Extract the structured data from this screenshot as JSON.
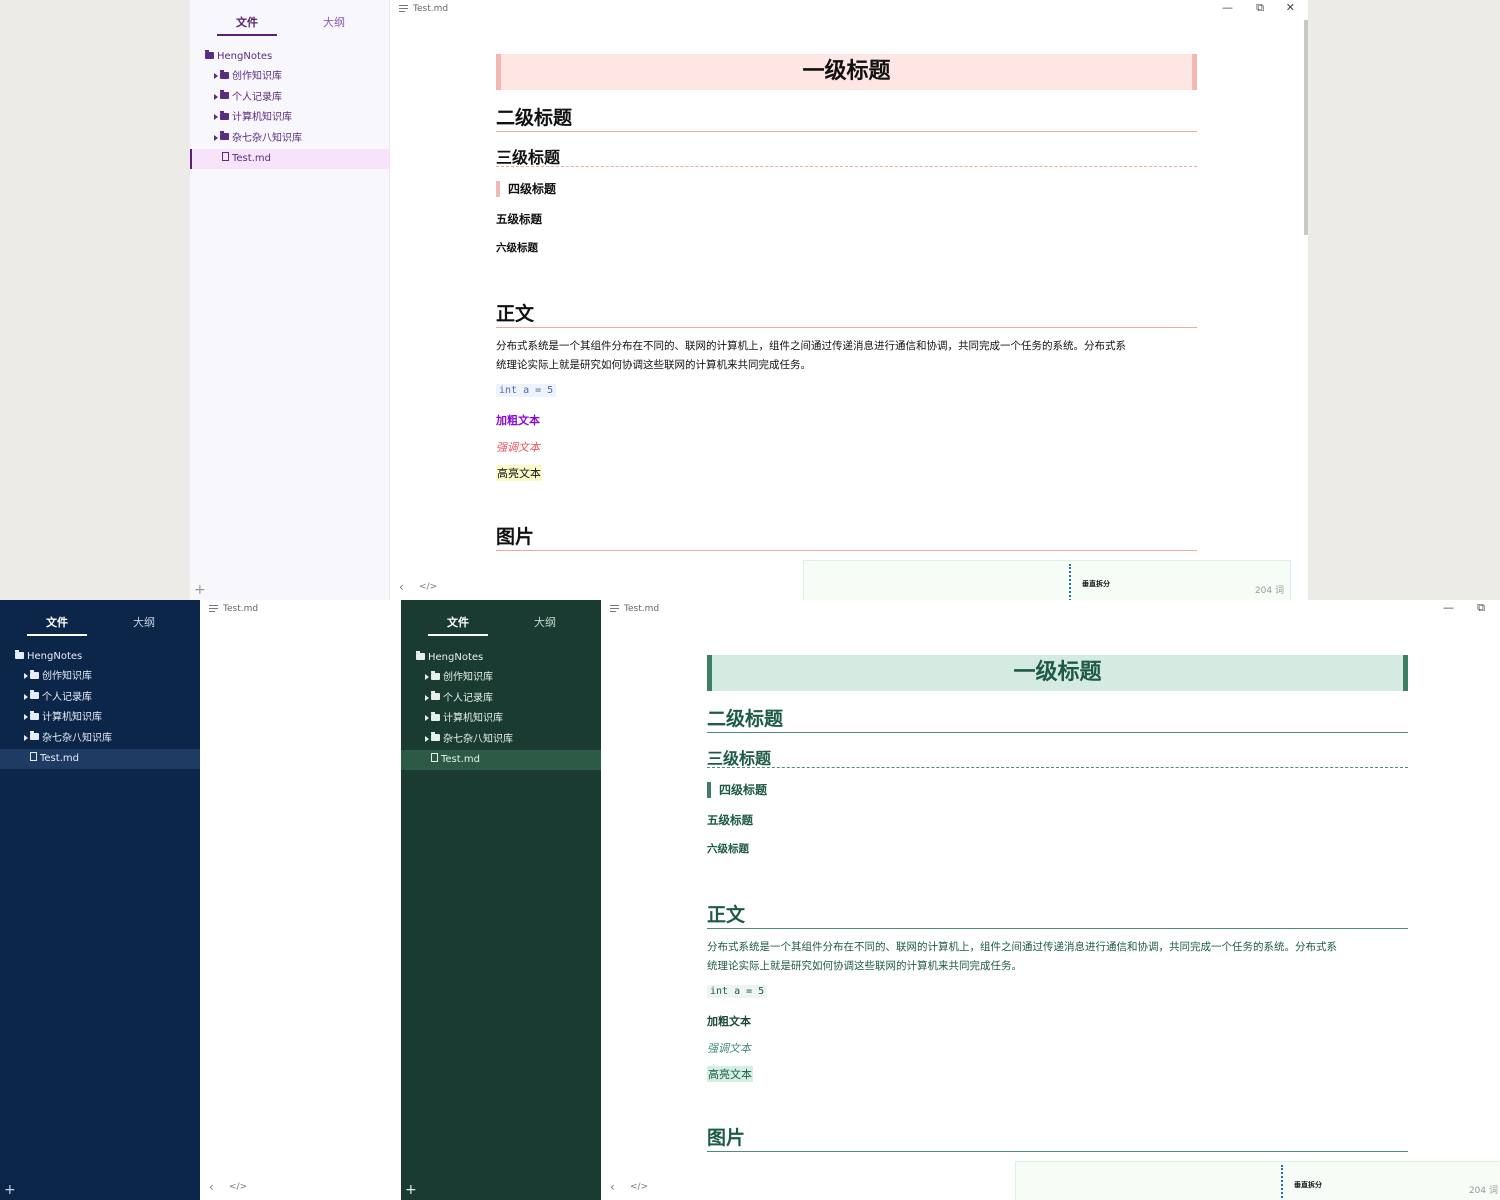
{
  "sidebar": {
    "tab_files": "文件",
    "tab_outline": "大纲",
    "root": "HengNotes",
    "folders": [
      "创作知识库",
      "个人记录库",
      "计算机知识库",
      "杂七杂八知识库"
    ],
    "file": "Test.md",
    "add": "+"
  },
  "editor": {
    "title": "Test.md",
    "h1": "一级标题",
    "h2": "二级标题",
    "h3": "三级标题",
    "h4": "四级标题",
    "h5": "五级标题",
    "h6": "六级标题",
    "body_heading": "正文",
    "paragraph_line1": "分布式系统是一个其组件分布在不同的、联网的计算机上，组件之间通过传递消息进行通信和协调，共同完成一个任务的系统。分布式系",
    "paragraph_line2": "统理论实际上就是研究如何协调这些联网的计算机来共同完成任务。",
    "code": "int a = 5",
    "bold": "加粗文本",
    "italic": "强调文本",
    "highlight": "高亮文本",
    "image_heading": "图片",
    "diagram_label": "垂直拆分",
    "word_count": "204 词",
    "window_controls": {
      "minimize": "—",
      "restore": "⧉",
      "close": "✕"
    },
    "nav_back": "‹",
    "source_toggle": "</>"
  },
  "themes": {
    "lavender": {
      "sidebar_bg": "#f8f7fb",
      "sidebar_text": "#5b2c83",
      "active_row": "#f7e4fa",
      "accent": "#5b1e7a",
      "h1_bg": "#fde6e4",
      "h1_border": "#f4b8b2",
      "rule": "#f0a8a0",
      "heading": "#111111",
      "body": "#111111",
      "bold": "#8a0ad8",
      "italic": "#e8535b",
      "mark": "#fbfbc9",
      "code_text": "#4a6fb0",
      "code_bg": "#eef2fa",
      "diagram_bg": "#f5fdf6",
      "diagram_dots": "#1f6fa8"
    },
    "navy": {
      "sidebar_bg": "#0c264a",
      "sidebar_text": "#e6ecf5",
      "active_row": "#1d3b63",
      "accent": "#ffffff",
      "h1_bg": "#e5edf8",
      "h1_border": "#0c2a5a",
      "rule": "#8aa6c8",
      "heading": "#0c2a5a",
      "body": "#111111",
      "bold": "#111111",
      "italic": "#2a5a9a",
      "mark": "#e3ecf8",
      "code_text": "#2a4a80",
      "code_bg": "#eef2fa"
    },
    "forest": {
      "sidebar_bg": "#1a3b31",
      "sidebar_text": "#e6f0ea",
      "active_row": "#2d5a46",
      "accent": "#ffffff",
      "h1_bg": "#d5ebe2",
      "h1_border": "#3d7f63",
      "rule": "#4f8c74",
      "heading": "#1e5a48",
      "body": "#1e5a48",
      "bold": "#1e4a3a",
      "italic": "#3c8a80",
      "mark": "#d6efe3",
      "code_text": "#1e5a48",
      "code_bg": "#eef5f1",
      "diagram_bg": "#f5fdf6",
      "diagram_dots": "#1f6fa8"
    }
  }
}
